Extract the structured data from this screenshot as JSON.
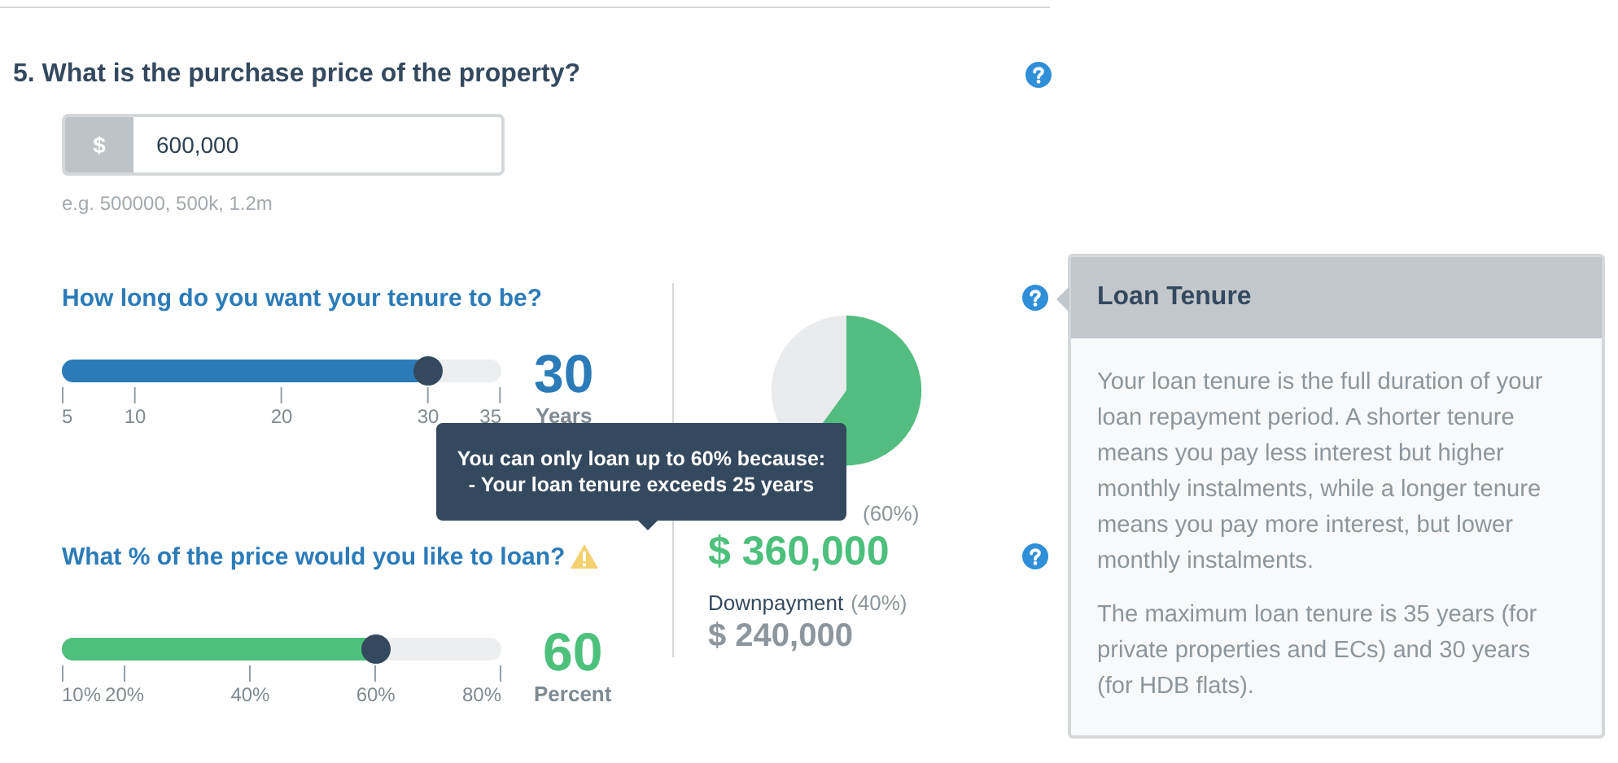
{
  "question": {
    "title": "5. What is the purchase price of the property?"
  },
  "price_input": {
    "prefix": "$",
    "value": "600,000",
    "hint": "e.g. 500000, 500k, 1.2m"
  },
  "sliders": [
    {
      "question": "How long do you want your tenure to be?",
      "color": "#2b7bb9",
      "level": 0.833,
      "ticks": [
        "5",
        "10",
        "20",
        "30",
        "35"
      ],
      "value": "30",
      "unit": "Years",
      "warning": false
    },
    {
      "question": "What % of the price would you like to loan?",
      "color": "#4cc07c",
      "level": 0.714,
      "ticks": [
        "10%",
        "20%",
        "40%",
        "60%",
        "80%"
      ],
      "value": "60",
      "unit": "Percent",
      "warning": true
    }
  ],
  "tooltip": {
    "lines": [
      "You can only loan up to 60% because:",
      "- Your loan tenure exceeds 25 years"
    ]
  },
  "summary": {
    "loan_share": "(60%)",
    "loan_amount": "$ 360,000",
    "downpayment_label": "Downpayment",
    "downpayment_share": "(40%)",
    "downpayment_amount": "$ 240,000"
  },
  "help_popover": {
    "title": "Loan Tenure",
    "paragraphs": [
      "Your loan tenure is the full duration of your loan repayment period. A shorter tenure means you pay less interest but higher monthly instalments, while a longer tenure means you pay more interest, but lower monthly instalments.",
      "The maximum loan tenure is 35 years (for private properties and ECs) and 30 years (for HDB flats)."
    ]
  }
}
